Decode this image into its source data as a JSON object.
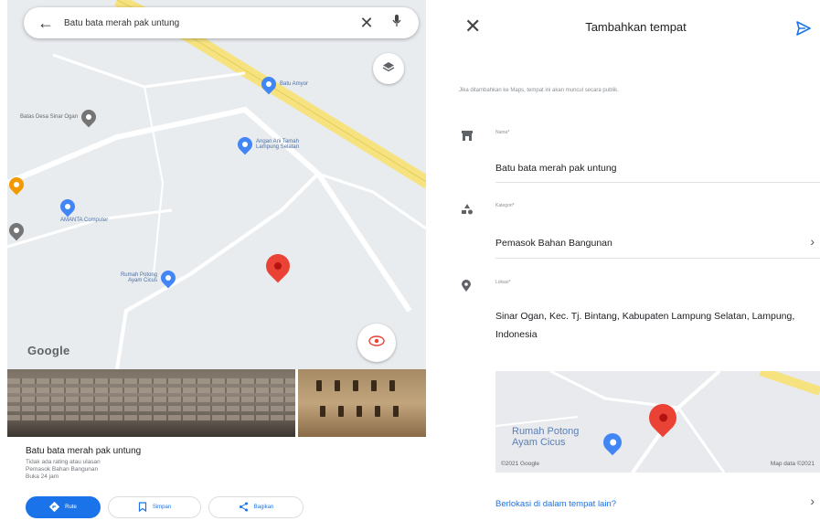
{
  "left": {
    "search": {
      "query": "Batu bata merah pak untung",
      "back_icon": "arrow-back-icon",
      "clear_icon": "close-icon",
      "mic_icon": "mic-icon"
    },
    "map": {
      "pois": [
        {
          "label": "Batu Amyor",
          "color": "#4285f4"
        },
        {
          "label": "Batas Desa Sinar Ogan",
          "color": "#757575"
        },
        {
          "label": "Angan Ani Tamah Lampung Selatan",
          "color": "#4285f4"
        },
        {
          "label": "AMANTA Computer",
          "color": "#4285f4"
        },
        {
          "label": "Rumah Potong Ayam Cicus",
          "color": "#4285f4"
        }
      ],
      "logo": "Google"
    },
    "place": {
      "name": "Batu bata merah pak untung",
      "rating": "Tidak ada rating atau ulasan",
      "category": "Pemasok Bahan Bangunan",
      "hours": "Buka 24 jam"
    },
    "actions": {
      "route": "Rute",
      "save": "Simpan",
      "share": "Bagikan"
    }
  },
  "right": {
    "title": "Tambahkan tempat",
    "notice": "Jika ditambahkan ke Maps, tempat ini akan muncul secara publik.",
    "name_field": {
      "label": "Nama*",
      "value": "Batu bata merah pak untung"
    },
    "category_field": {
      "label": "Kategori*",
      "value": "Pemasok Bahan Bangunan"
    },
    "location_field": {
      "label": "Lokasi*",
      "value": "Sinar Ogan, Kec. Tj. Bintang, Kabupaten Lampung Selatan, Lampung, Indonesia"
    },
    "mini_map": {
      "poi": "Rumah Potong Ayam Cicus",
      "copyright": "©2021 Google",
      "map_data": "Map data ©2021"
    },
    "other_place": "Berlokasi di dalam tempat lain?"
  },
  "colors": {
    "accent": "#1a73e8",
    "marker": "#ea4335",
    "road_yellow": "#f6e27f"
  }
}
